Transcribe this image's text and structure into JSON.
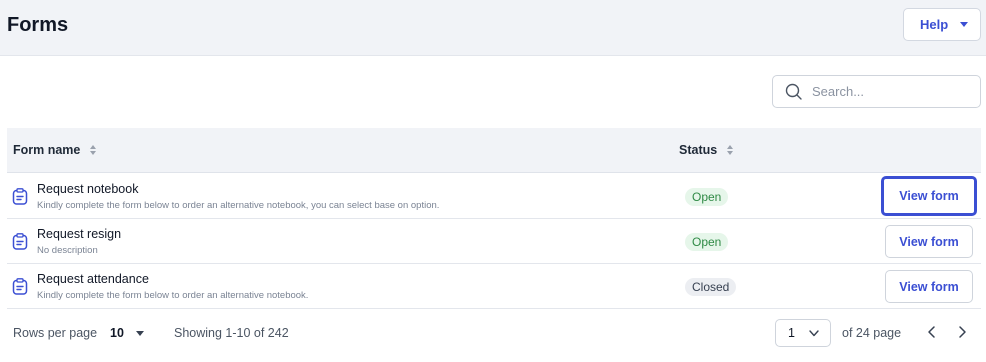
{
  "header": {
    "title": "Forms",
    "help_label": "Help"
  },
  "search": {
    "placeholder": "Search..."
  },
  "table": {
    "columns": [
      {
        "label": "Form name"
      },
      {
        "label": "Status"
      }
    ],
    "rows": [
      {
        "title": "Request notebook",
        "description": "Kindly complete the form below to order an alternative notebook, you can select base on option.",
        "status": "Open",
        "action": "View form"
      },
      {
        "title": "Request resign",
        "description": "No description",
        "status": "Open",
        "action": "View form"
      },
      {
        "title": "Request attendance",
        "description": "Kindly complete the form below to order an alternative notebook.",
        "status": "Closed",
        "action": "View form"
      }
    ]
  },
  "footer": {
    "rows_per_page_label": "Rows per page",
    "rows_per_page_value": "10",
    "showing": "Showing 1-10 of 242",
    "page_value": "1",
    "of_pages": "of 24 page"
  },
  "colors": {
    "accent": "#3b4fd3",
    "open_badge_bg": "#e6f6ea",
    "open_badge_text": "#2f8a45",
    "closed_badge_bg": "#eceef2"
  },
  "icons": [
    "caret-down-icon",
    "search-icon",
    "sort-icon",
    "clipboard-icon",
    "chevron-down-icon",
    "chevron-left-icon",
    "chevron-right-icon"
  ]
}
